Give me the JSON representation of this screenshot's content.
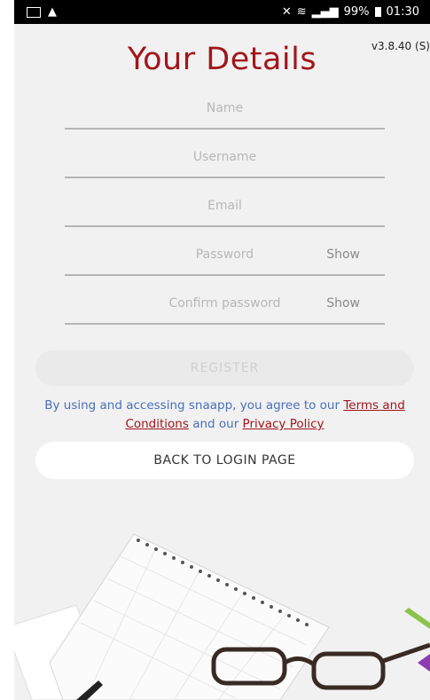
{
  "status_bar": {
    "signal_text": "99%",
    "time": "01:30"
  },
  "app": {
    "version": "v3.8.40 (S)",
    "title": "Your Details"
  },
  "form": {
    "name_placeholder": "Name",
    "username_placeholder": "Username",
    "email_placeholder": "Email",
    "password_placeholder": "Password",
    "password_show": "Show",
    "confirm_placeholder": "Confirm password",
    "confirm_show": "Show",
    "register_label": "REGISTER"
  },
  "terms": {
    "prefix": "By using and accessing snaapp, you agree to our ",
    "terms_link": "Terms and Conditions",
    "middle": " and our ",
    "privacy_link": "Privacy Policy"
  },
  "back_label": "BACK TO LOGIN PAGE",
  "colors": {
    "brand_red": "#a1161b",
    "link_blue": "#4a6fb8",
    "background": "#f1f1f1"
  }
}
